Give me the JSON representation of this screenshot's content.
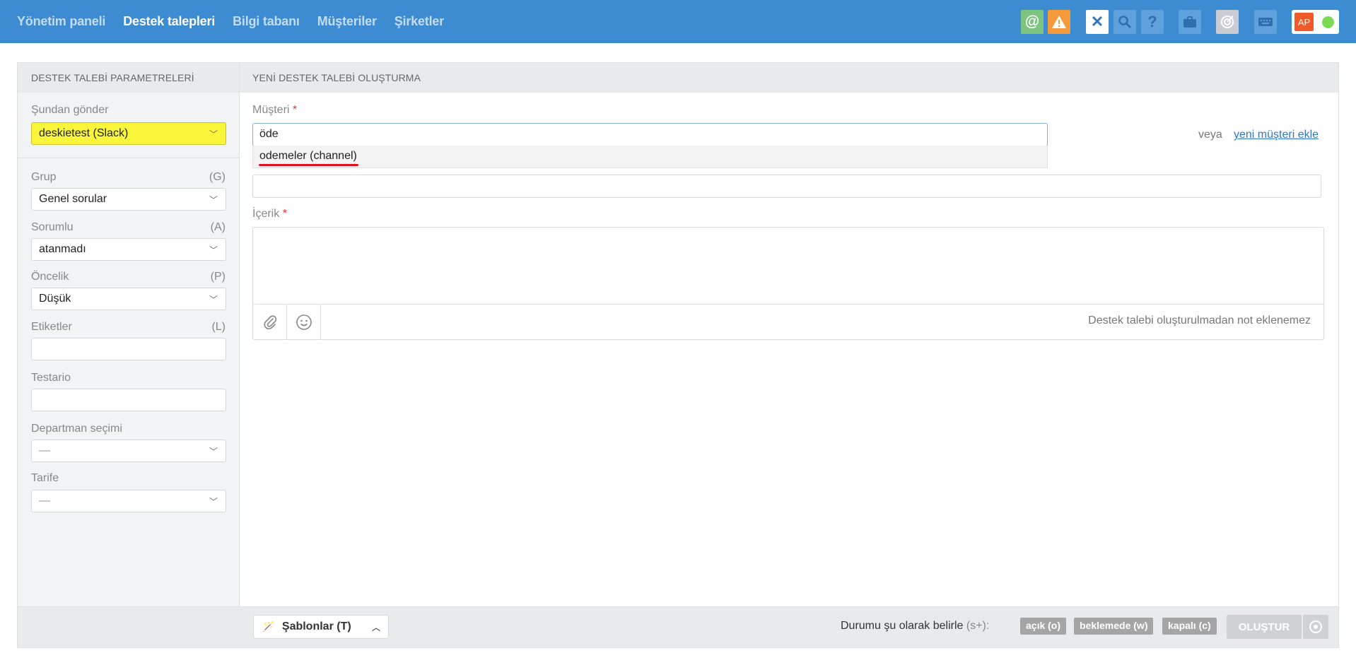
{
  "nav": {
    "items": [
      "Yönetim paneli",
      "Destek talepleri",
      "Bilgi tabanı",
      "Müşteriler",
      "Şirketler"
    ],
    "active": "Destek talepleri"
  },
  "toolbar": {
    "icons": [
      "at-icon",
      "warning-icon",
      "close-icon",
      "search-icon",
      "help-icon",
      "briefcase-icon",
      "target-icon",
      "keyboard-icon"
    ],
    "avatar_initials": "AP",
    "status_color": "#7ed957",
    "bar_color": "#3d8bd0"
  },
  "left_panel": {
    "header": "DESTEK TALEBİ PARAMETRELERİ",
    "send_from": {
      "label": "Şundan gönder",
      "value": "deskietest (Slack)"
    },
    "group": {
      "label": "Grup",
      "shortcut": "(G)",
      "value": "Genel sorular"
    },
    "assignee": {
      "label": "Sorumlu",
      "shortcut": "(A)",
      "value": "atanmadı"
    },
    "priority": {
      "label": "Öncelik",
      "shortcut": "(P)",
      "value": "Düşük"
    },
    "tags": {
      "label": "Etiketler",
      "shortcut": "(L)",
      "value": ""
    },
    "testario": {
      "label": "Testario",
      "value": ""
    },
    "department": {
      "label": "Departman seçimi",
      "value": "—"
    },
    "tariff": {
      "label": "Tarife",
      "value": "—"
    }
  },
  "main": {
    "header": "YENİ DESTEK TALEBİ OLUŞTURMA",
    "customer": {
      "label": "Müşteri",
      "required_mark": "*",
      "value": "öde",
      "suggestion": "odemeler (channel)",
      "or_text": "veya",
      "add_new_link": "yeni müşteri ekle"
    },
    "content": {
      "label": "İçerik",
      "required_mark": "*",
      "note": "Destek talebi oluşturulmadan not eklenemez"
    }
  },
  "footer": {
    "templates_button": "Şablonlar (T)",
    "status_label": "Durumu şu olarak belirle",
    "status_shortcut": "(s+):",
    "statuses": [
      "açık (o)",
      "beklemede (w)",
      "kapalı (c)"
    ],
    "create_button": "OLUŞTUR"
  }
}
